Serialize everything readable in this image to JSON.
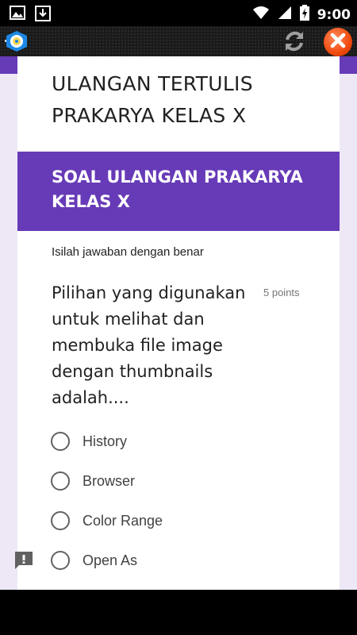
{
  "status_bar": {
    "time": "9:00",
    "left_icons": [
      "image-icon",
      "download-icon"
    ],
    "right_icons": [
      "wifi-icon",
      "signal-icon",
      "battery-charging-icon"
    ]
  },
  "app_bar": {
    "logo": "tut-wuri-handayani-logo",
    "actions": [
      "refresh-icon",
      "close-icon"
    ]
  },
  "form": {
    "title": "ULANGAN TERTULIS PRAKARYA KELAS X",
    "section_title": "SOAL ULANGAN PRAKARYA KELAS X",
    "description": "Isilah jawaban dengan benar",
    "question": {
      "text": "Pilihan yang digunakan untuk melihat dan membuka file image dengan thumbnails adalah....",
      "points": "5 points",
      "options": [
        "History",
        "Browser",
        "Color Range",
        "Open As"
      ]
    }
  },
  "colors": {
    "accent": "#673ab7",
    "background": "#ede7f6",
    "close": "#f04a0e"
  }
}
